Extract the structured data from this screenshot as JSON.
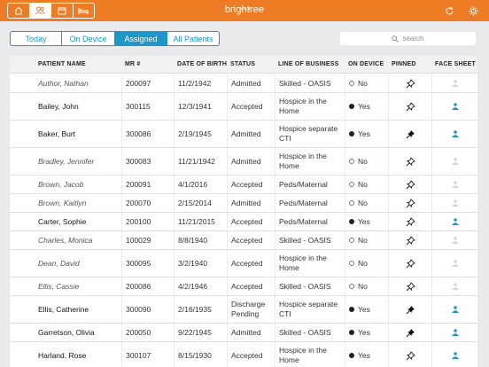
{
  "brand": "brightree",
  "colors": {
    "accent": "#ee7c24",
    "primary": "#1d97c9"
  },
  "nav": {
    "icons": [
      "home-icon",
      "patients-icon",
      "calendar-icon",
      "bed-icon"
    ],
    "active_index": 1
  },
  "top_right": {
    "refresh_icon": "refresh-icon",
    "settings_icon": "gear-icon"
  },
  "filters": {
    "tabs": [
      "Today",
      "On Device",
      "Assigned",
      "All Patients"
    ],
    "active": "Assigned"
  },
  "search": {
    "placeholder": "search"
  },
  "table": {
    "columns": [
      "PATIENT NAME",
      "MR #",
      "DATE OF BIRTH",
      "STATUS",
      "LINE OF BUSINESS",
      "ON DEVICE",
      "PINNED",
      "FACE SHEET"
    ],
    "rows": [
      {
        "name": "Author, Nathan",
        "mr": "200097",
        "dob": "11/2/1942",
        "status": "Admitted",
        "lob": "Skilled - OASIS",
        "on_device": "No",
        "pinned": false,
        "face_sheet": false
      },
      {
        "name": "Bailey, John",
        "mr": "300115",
        "dob": "12/3/1941",
        "status": "Accepted",
        "lob": "Hospice in the Home",
        "on_device": "Yes",
        "pinned": false,
        "face_sheet": true
      },
      {
        "name": "Baker, Burt",
        "mr": "300086",
        "dob": "2/19/1945",
        "status": "Admitted",
        "lob": "Hospice separate CTI",
        "on_device": "Yes",
        "pinned": true,
        "face_sheet": true
      },
      {
        "name": "Bradley, Jennifer",
        "mr": "300083",
        "dob": "11/21/1942",
        "status": "Admitted",
        "lob": "Hospice in the Home",
        "on_device": "No",
        "pinned": false,
        "face_sheet": false
      },
      {
        "name": "Brown, Jacob",
        "mr": "200091",
        "dob": "4/1/2016",
        "status": "Accepted",
        "lob": "Peds/Maternal",
        "on_device": "No",
        "pinned": false,
        "face_sheet": false
      },
      {
        "name": "Brown, Kaitlyn",
        "mr": "200070",
        "dob": "2/15/2014",
        "status": "Admitted",
        "lob": "Peds/Maternal",
        "on_device": "No",
        "pinned": false,
        "face_sheet": false
      },
      {
        "name": "Carter, Sophie",
        "mr": "200100",
        "dob": "11/21/2015",
        "status": "Accepted",
        "lob": "Peds/Maternal",
        "on_device": "Yes",
        "pinned": false,
        "face_sheet": true
      },
      {
        "name": "Charles, Monica",
        "mr": "100029",
        "dob": "8/8/1940",
        "status": "Accepted",
        "lob": "Skilled - OASIS",
        "on_device": "No",
        "pinned": false,
        "face_sheet": false
      },
      {
        "name": "Dean, David",
        "mr": "300095",
        "dob": "3/2/1940",
        "status": "Accepted",
        "lob": "Hospice in the Home",
        "on_device": "No",
        "pinned": false,
        "face_sheet": false
      },
      {
        "name": "Ellis, Cassie",
        "mr": "200086",
        "dob": "4/2/1946",
        "status": "Accepted",
        "lob": "Skilled - OASIS",
        "on_device": "No",
        "pinned": false,
        "face_sheet": false
      },
      {
        "name": "Ellis, Catherine",
        "mr": "300090",
        "dob": "2/16/1935",
        "status": "Discharge Pending",
        "lob": "Hospice separate CTI",
        "on_device": "Yes",
        "pinned": true,
        "face_sheet": true
      },
      {
        "name": "Garretson, Olivia",
        "mr": "200050",
        "dob": "9/22/1945",
        "status": "Admitted",
        "lob": "Skilled - OASIS",
        "on_device": "Yes",
        "pinned": true,
        "face_sheet": true
      },
      {
        "name": "Harland, Rose",
        "mr": "300107",
        "dob": "8/15/1930",
        "status": "Accepted",
        "lob": "Hospice in the Home",
        "on_device": "Yes",
        "pinned": false,
        "face_sheet": true
      }
    ]
  }
}
